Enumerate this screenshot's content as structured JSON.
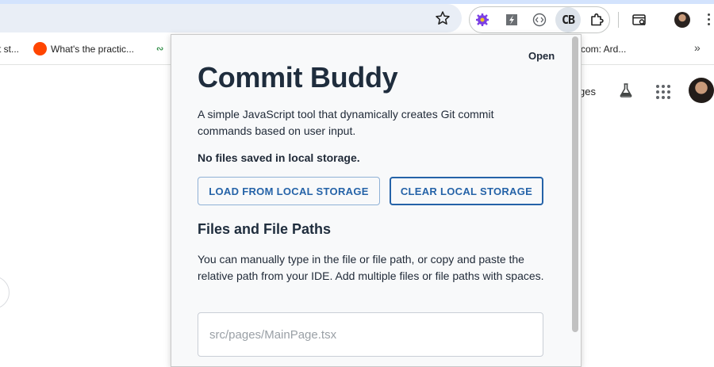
{
  "browser": {
    "bookmarks": [
      {
        "label": "t st..."
      },
      {
        "label": "What's the practic..."
      },
      {
        "label": "com: Ard..."
      }
    ],
    "icons": [
      "star-icon",
      "gear-extension-icon",
      "bolt-extension-icon",
      "code-extension-icon",
      "puzzle-icon",
      "tab-search-icon",
      "chevron-double-right-icon"
    ],
    "cb_extension_label": "CB"
  },
  "page": {
    "partial_text": "ges"
  },
  "popup": {
    "open_label": "Open",
    "title": "Commit Buddy",
    "description": "A simple JavaScript tool that dynamically creates Git commit commands based on user input.",
    "status": "No files saved in local storage.",
    "load_button": "LOAD FROM LOCAL STORAGE",
    "clear_button": "CLEAR LOCAL STORAGE",
    "section_title": "Files and File Paths",
    "help_text": "You can manually type in the file or file path, or copy and paste the relative path from your IDE. Add multiple files or file paths with spaces.",
    "input_placeholder": "src/pages/MainPage.tsx",
    "input_value": ""
  },
  "colors": {
    "accent": "#2563a8",
    "title": "#1f2d3d",
    "popup_bg": "#f8f9fa"
  }
}
